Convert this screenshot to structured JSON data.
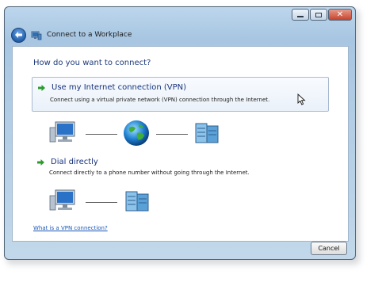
{
  "window": {
    "title": "Connect to a Workplace",
    "controls": {
      "minimize": "minimize",
      "maximize": "maximize",
      "close": "✕"
    }
  },
  "prompt": {
    "question": "How do you want to connect?"
  },
  "options": [
    {
      "title": "Use my Internet connection (VPN)",
      "description": "Connect using a virtual private network (VPN) connection through the Internet."
    },
    {
      "title": "Dial directly",
      "description": "Connect directly to a phone number without going through the Internet."
    }
  ],
  "help_link": "What is a VPN connection?",
  "footer": {
    "cancel_label": "Cancel"
  },
  "icons": {
    "back": "back-arrow-icon",
    "app": "network-connection-icon",
    "option_arrow": "green-arrow-icon",
    "computer": "computer-icon",
    "internet": "globe-icon",
    "server": "server-icon",
    "cursor": "mouse-pointer-icon"
  },
  "colors": {
    "title_text": "#1e3a7b",
    "link": "#1b58b8",
    "option_arrow": "#2e9b2e",
    "close_button": "#c5432d"
  }
}
